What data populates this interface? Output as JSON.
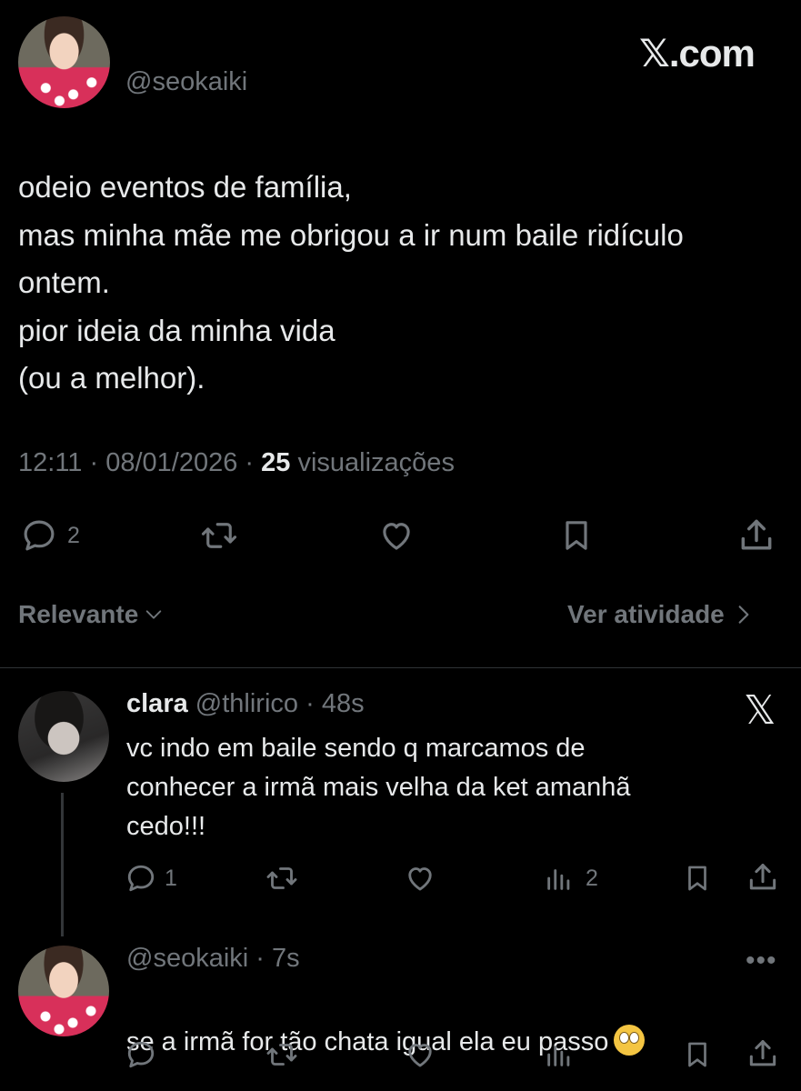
{
  "brand": "𝕏.com",
  "main_tweet": {
    "handle": "@seokaiki",
    "text": "odeio eventos de família,\nmas minha mãe me obrigou a ir num baile ridículo\nontem.\npior ideia da minha vida\n(ou a melhor).",
    "time": "12:11",
    "date": "08/01/2026",
    "views_count": "25",
    "views_label": "visualizações",
    "replies_count": "2"
  },
  "sort": {
    "label": "Relevante",
    "activity_label": "Ver atividade"
  },
  "replies": [
    {
      "name": "clara",
      "handle": "@thlirico",
      "time": "48s",
      "text": "vc indo em baile sendo q marcamos de\nconhecer a irmã mais velha da ket amanhã\ncedo!!!",
      "reply_count": "1",
      "views_count": "2"
    },
    {
      "handle": "@seokaiki",
      "time": "7s",
      "text": "se a irmã for tão chata igual ela eu passo",
      "emoji": "face-with-rolling-eyes"
    }
  ],
  "colors": {
    "background": "#000000",
    "text": "#e7e9ea",
    "muted": "#71767b",
    "divider": "#2f3336"
  }
}
